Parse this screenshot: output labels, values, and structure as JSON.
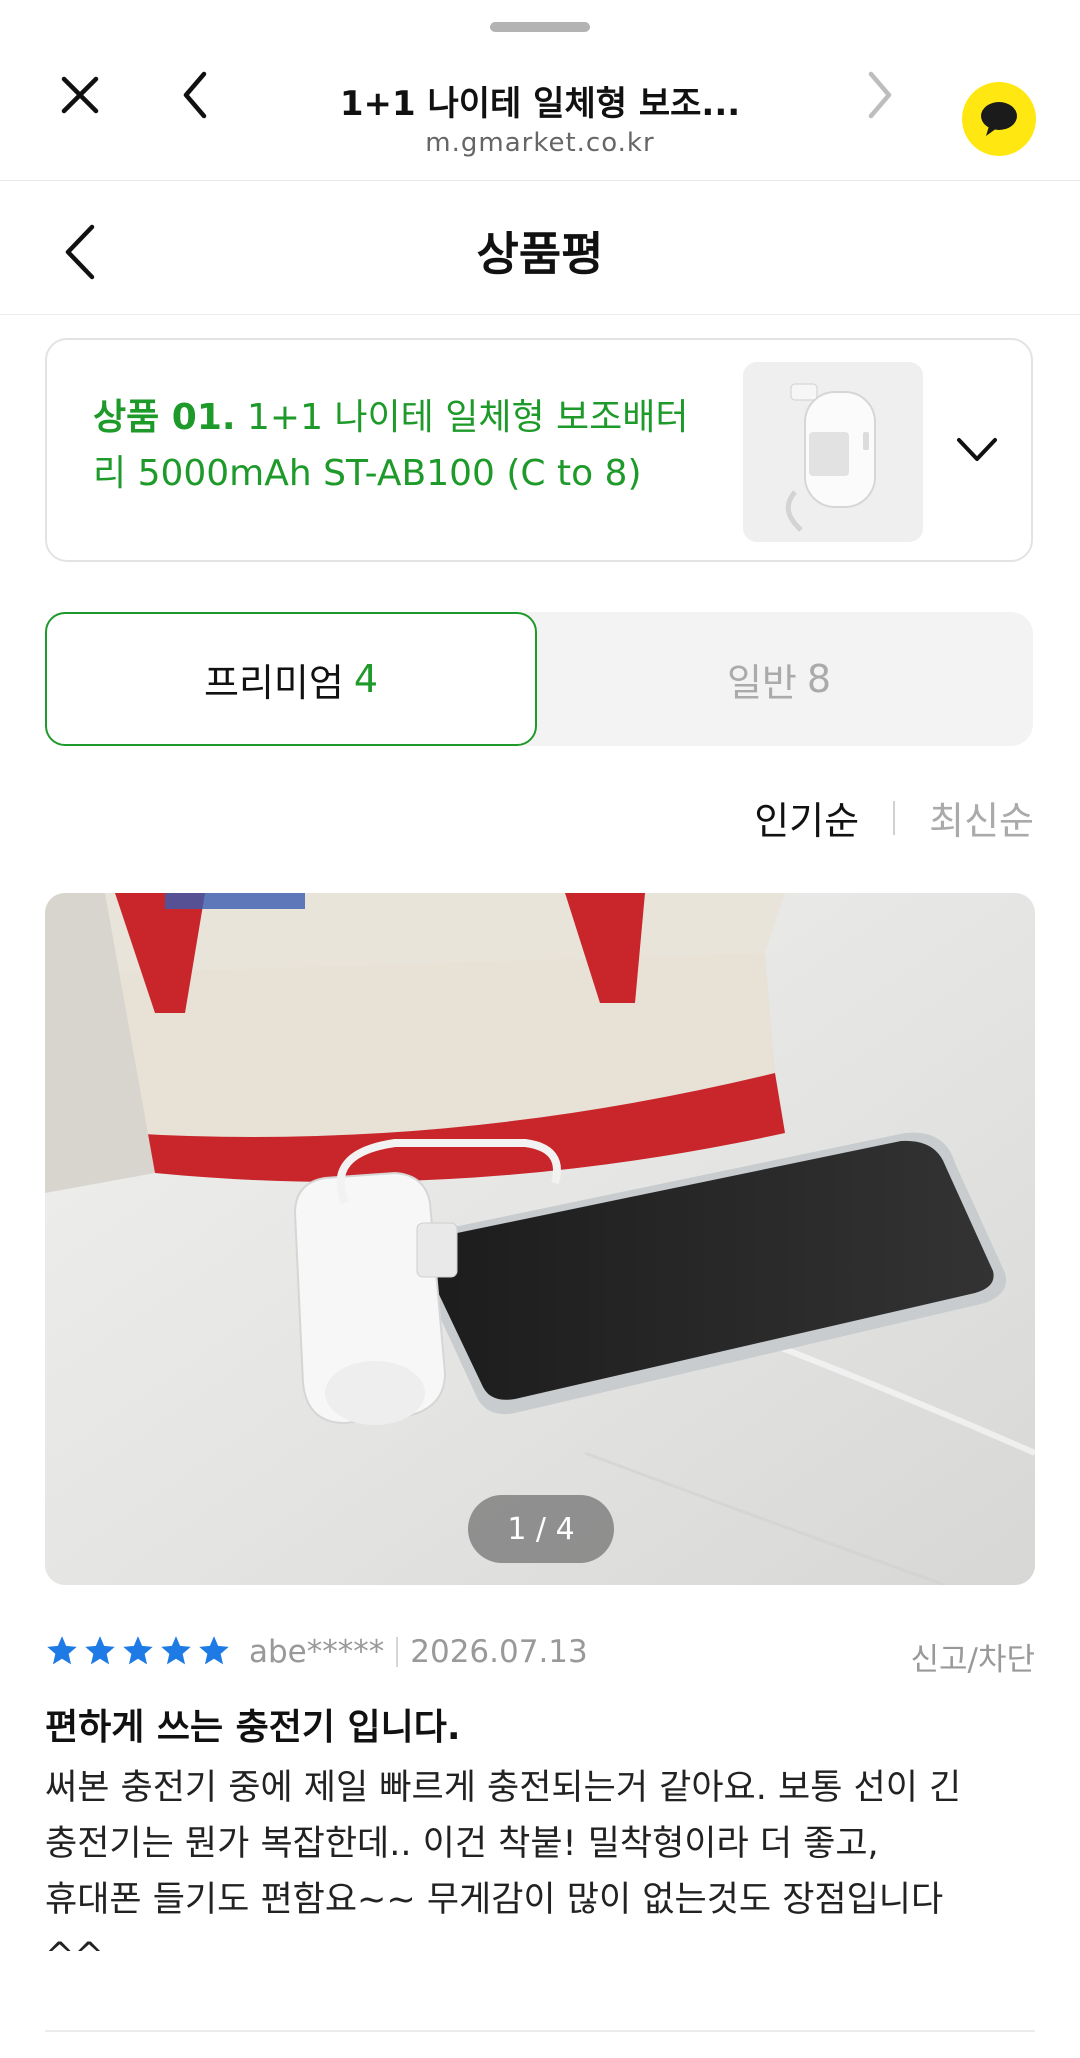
{
  "browser": {
    "title": "1+1 나이테 일체형 보조...",
    "url": "m.gmarket.co.kr"
  },
  "page": {
    "title": "상품평"
  },
  "product": {
    "prefix": "상품 01.",
    "name": "1+1 나이테 일체형 보조배터리 5000mAh ST-AB100 (C to 8)"
  },
  "tabs": {
    "premium_label": "프리미엄",
    "premium_count": "4",
    "general_label": "일반",
    "general_count": "8"
  },
  "sort": {
    "active": "인기순",
    "inactive": "최신순"
  },
  "review": {
    "image_counter": "1 / 4",
    "rating": 5,
    "reviewer": "abe*****",
    "date": "2026.07.13",
    "report_label": "신고/차단",
    "title": "편하게 쓰는 충전기 입니다.",
    "body": "써본 충전기 중에 제일 빠르게 충전되는거 같아요. 보통 선이 긴 충전기는 뭔가 복잡한데.. 이건 착붙! 밀착형이라 더 좋고, 휴대폰 들기도 편함요~~ 무게감이 많이 없는것도 장점입니다^^"
  },
  "colors": {
    "accent_green": "#1e9a2a",
    "kakao_yellow": "#ffe812",
    "star_blue": "#1e7be6"
  }
}
